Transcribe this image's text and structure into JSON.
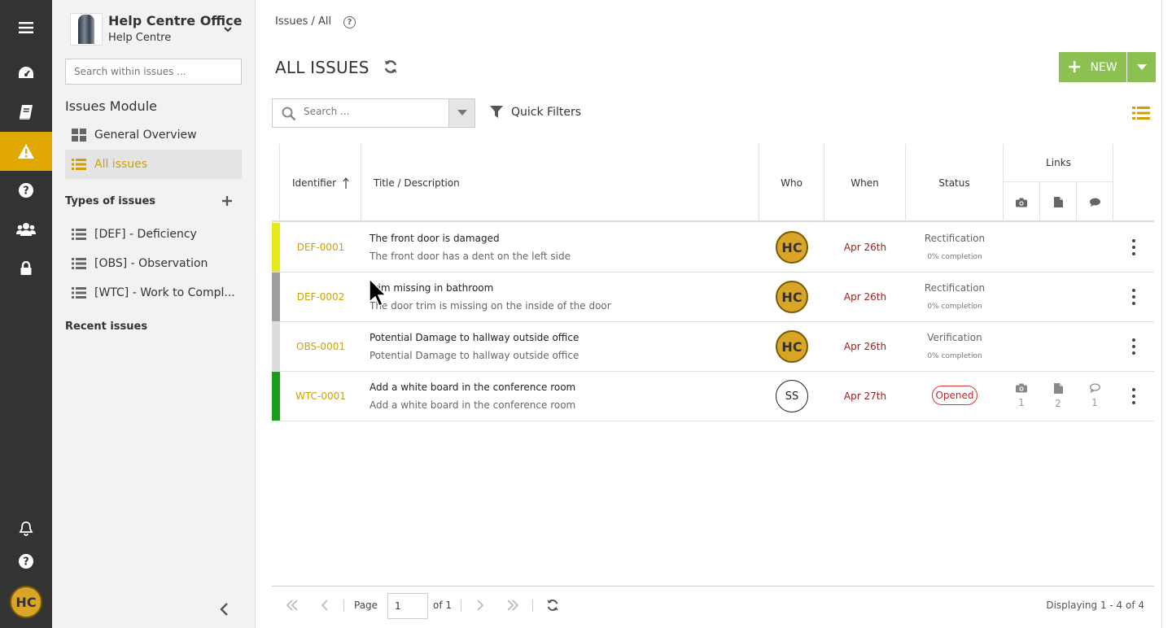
{
  "rail": {
    "avatar": "HC"
  },
  "panel": {
    "project_name": "Help Centre Office",
    "project_sub": "Help Centre",
    "search_placeholder": "Search within issues ...",
    "module_title": "Issues Module",
    "nav": [
      {
        "label": "General Overview"
      },
      {
        "label": "All issues"
      }
    ],
    "types_title": "Types of issues",
    "types": [
      {
        "label": "[DEF] - Deficiency"
      },
      {
        "label": "[OBS] - Observation"
      },
      {
        "label": "[WTC] - Work to Compl..."
      }
    ],
    "recent_title": "Recent issues"
  },
  "header": {
    "breadcrumb": "Issues / All",
    "help": "?",
    "title": "ALL ISSUES",
    "new_label": "NEW"
  },
  "toolbar": {
    "search_placeholder": "Search ...",
    "quick_filters": "Quick Filters"
  },
  "table": {
    "columns": {
      "identifier": "Identifier",
      "title": "Title / Description",
      "who": "Who",
      "when": "When",
      "status": "Status",
      "links": "Links"
    },
    "rows": [
      {
        "id": "DEF-0001",
        "stripe": "#e8e81a",
        "title": "The front door is damaged",
        "desc": "The front door has a dent on the left side",
        "who": "HC",
        "when": "Apr 26th",
        "status": "Rectification",
        "completion": "0% completion"
      },
      {
        "id": "DEF-0002",
        "stripe": "#9e9e9e",
        "title": "Trim missing in bathroom",
        "desc": "The door trim is missing on the inside of the door",
        "who": "HC",
        "when": "Apr 26th",
        "status": "Rectification",
        "completion": "0% completion"
      },
      {
        "id": "OBS-0001",
        "stripe": "#dcdcdc",
        "title": "Potential Damage to hallway outside office",
        "desc": "Potential Damage to hallway outside office",
        "who": "HC",
        "when": "Apr 26th",
        "status": "Verification",
        "completion": "0% completion"
      },
      {
        "id": "WTC-0001",
        "stripe": "#1a9e1a",
        "title": "Add a white board in the conference room",
        "desc": "Add a white board in the conference room",
        "who": "SS",
        "when": "Apr 27th",
        "status": "Opened",
        "photos": "1",
        "docs": "2",
        "comments": "1"
      }
    ]
  },
  "pager": {
    "page_label": "Page",
    "page_value": "1",
    "of_label": "of 1",
    "display": "Displaying 1 - 4 of 4"
  },
  "colors": {
    "accent": "#e0a800",
    "new_button": "#8cc152",
    "rail": "#333333"
  }
}
